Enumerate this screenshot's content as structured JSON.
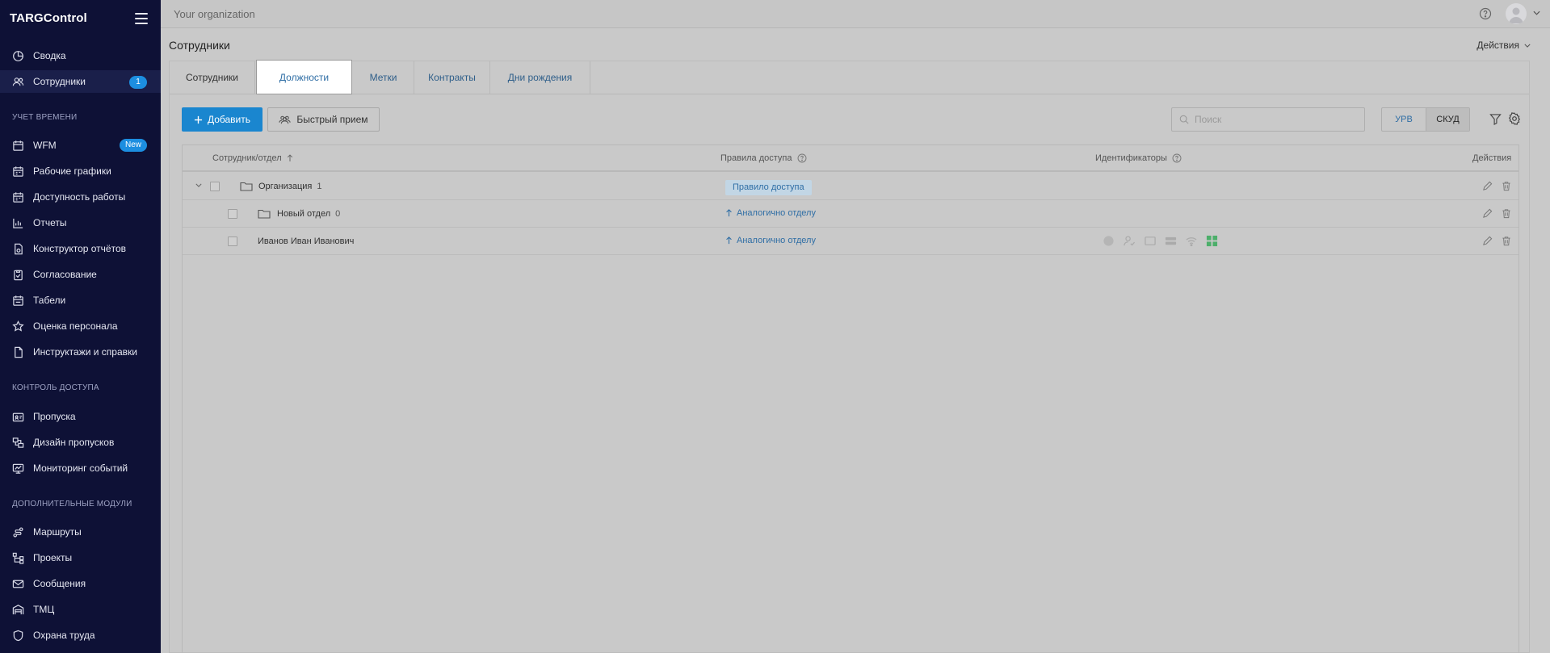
{
  "app": {
    "brand": "TARGControl",
    "organization": "Your organization"
  },
  "sidebar": {
    "items": [
      {
        "label": "Сводка",
        "icon": "dashboard-icon"
      },
      {
        "label": "Сотрудники",
        "icon": "users-icon",
        "badge": "1",
        "active": true
      },
      {
        "label": "WFM",
        "icon": "calendar-icon",
        "badge": "New"
      },
      {
        "label": "Рабочие графики",
        "icon": "calendar-grid-icon"
      },
      {
        "label": "Доступность работы",
        "icon": "calendar-grid-icon"
      },
      {
        "label": "Отчеты",
        "icon": "bar-chart-icon"
      },
      {
        "label": "Конструктор отчётов",
        "icon": "document-cog-icon"
      },
      {
        "label": "Согласование",
        "icon": "clipboard-check-icon"
      },
      {
        "label": "Табели",
        "icon": "calendar-icon"
      },
      {
        "label": "Оценка персонала",
        "icon": "star-icon"
      },
      {
        "label": "Инструктажи и справки",
        "icon": "file-icon"
      },
      {
        "label": "Пропуска",
        "icon": "id-card-icon"
      },
      {
        "label": "Дизайн пропусков",
        "icon": "card-design-icon"
      },
      {
        "label": "Мониторинг событий",
        "icon": "monitor-icon"
      },
      {
        "label": "Маршруты",
        "icon": "route-icon"
      },
      {
        "label": "Проекты",
        "icon": "hierarchy-icon"
      },
      {
        "label": "Сообщения",
        "icon": "envelope-icon"
      },
      {
        "label": "ТМЦ",
        "icon": "inventory-icon"
      },
      {
        "label": "Охрана труда",
        "icon": "shield-icon"
      }
    ],
    "sections": {
      "time": "УЧЕТ ВРЕМЕНИ",
      "access": "КОНТРОЛЬ ДОСТУПА",
      "extra": "ДОПОЛНИТЕЛЬНЫЕ МОДУЛИ"
    }
  },
  "page": {
    "title": "Сотрудники",
    "actions": "Действия"
  },
  "tabs": [
    "Сотрудники",
    "Должности",
    "Метки",
    "Контракты",
    "Дни рождения"
  ],
  "toolbar": {
    "add": "Добавить",
    "quick": "Быстрый прием",
    "search_placeholder": "Поиск",
    "seg": [
      "УРВ",
      "СКУД"
    ]
  },
  "table": {
    "headers": {
      "employee": "Сотрудник/отдел",
      "rules": "Правила доступа",
      "ids": "Идентификаторы",
      "actions": "Действия"
    },
    "rows": [
      {
        "name": "Организация",
        "count": "1",
        "rule": "Правило доступа"
      },
      {
        "name": "Новый отдел",
        "count": "0",
        "rule": "Аналогично отделу"
      },
      {
        "name": "Иванов Иван Иванович",
        "rule": "Аналогично отделу"
      }
    ]
  },
  "colors": {
    "sidebar": "#0e1136",
    "accent": "#1a86cf",
    "badge": "#1c8ee0",
    "link": "#2f6ea5"
  }
}
